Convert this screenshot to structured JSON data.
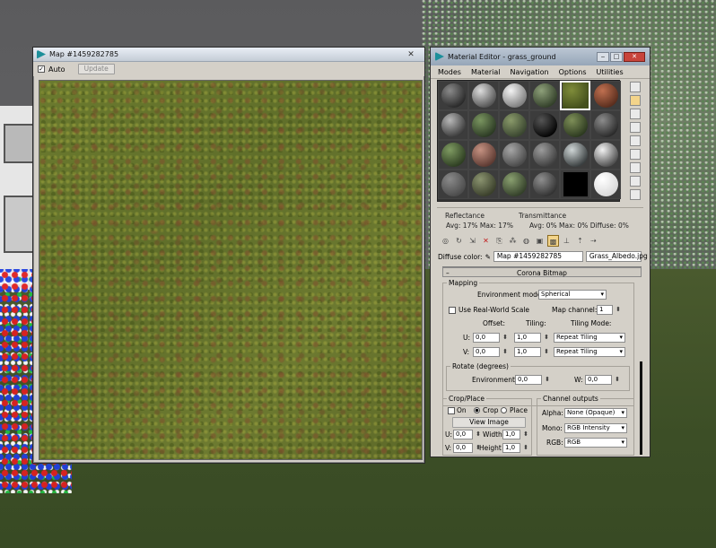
{
  "map_window": {
    "title": "Map #1459282785",
    "close": "✕",
    "auto_label": "Auto",
    "auto_checked": true,
    "update_label": "Update"
  },
  "material_editor": {
    "title": "Material Editor - grass_ground",
    "window_controls": [
      "‒",
      "□",
      "✕"
    ],
    "menu": [
      "Modes",
      "Material",
      "Navigation",
      "Options",
      "Utilities"
    ],
    "reflectance_label": "Reflectance",
    "reflectance_values": "Avg: 17% Max: 17%",
    "transmittance_label": "Transmittance",
    "transmittance_values": "Avg:  0% Max:   0% Diffuse:  0%",
    "diffuse_label": "Diffuse color:",
    "diffuse_map": "Map #1459282785",
    "diffuse_file": "Grass_Albedo.jpg",
    "rollout_title": "Corona Bitmap",
    "mapping_label": "Mapping",
    "env_mode_label": "Environment mode:",
    "env_mode_value": "Spherical",
    "real_world_label": "Use Real-World Scale",
    "map_channel_label": "Map channel:",
    "map_channel_value": "1",
    "offset_label": "Offset:",
    "tiling_label": "Tiling:",
    "tiling_mode_label": "Tiling Mode:",
    "u_label": "U:",
    "v_label": "V:",
    "u_offset": "0,0",
    "u_tiling": "1,0",
    "u_mode": "Repeat Tiling",
    "v_offset": "0,0",
    "v_tiling": "1,0",
    "v_mode": "Repeat Tiling",
    "rotate_label": "Rotate (degrees)",
    "environment_label": "Environment:",
    "environment_value": "0,0",
    "w_label": "W:",
    "w_value": "0,0",
    "crop_label": "Crop/Place",
    "on_label": "On",
    "crop_radio": "Crop",
    "place_radio": "Place",
    "view_image_label": "View Image",
    "u_crop": "0,0",
    "width_label": "Width",
    "width_value": "1,0",
    "v_crop": "0,0",
    "height_label": "Height",
    "height_value": "1,0",
    "channel_outputs_label": "Channel outputs",
    "alpha_label": "Alpha:",
    "alpha_value": "None (Opaque)",
    "mono_label": "Mono:",
    "mono_value": "RGB Intensity",
    "rgb_label": "RGB:",
    "rgb_value": "RGB"
  },
  "sample_slots": [
    {
      "name": "dark-rough-metal",
      "c1": "#8a8a8a",
      "c2": "#2a2a2a"
    },
    {
      "name": "brushed-metal",
      "c1": "#dddddd",
      "c2": "#555555"
    },
    {
      "name": "white-plaster",
      "c1": "#f4f4f4",
      "c2": "#7f7f7f"
    },
    {
      "name": "moss-stone",
      "c1": "#8ea07a",
      "c2": "#33402a"
    },
    {
      "name": "grass-ground",
      "c1": "#7f8c3a",
      "c2": "#44501c"
    },
    {
      "name": "rusty-metal",
      "c1": "#c07050",
      "c2": "#5a2e1e"
    },
    {
      "name": "checker-tile",
      "c1": "#b8b8b8",
      "c2": "#3a3a3a"
    },
    {
      "name": "green-stone",
      "c1": "#7a9560",
      "c2": "#2c3a24"
    },
    {
      "name": "mossy-rock",
      "c1": "#8a9a6a",
      "c2": "#3a4630"
    },
    {
      "name": "black-gloss",
      "c1": "#555555",
      "c2": "#050505"
    },
    {
      "name": "forest-ground",
      "c1": "#7e8f58",
      "c2": "#2d3a20"
    },
    {
      "name": "dark-stone",
      "c1": "#8c8c8c",
      "c2": "#2b2b2b"
    },
    {
      "name": "leaf-texture",
      "c1": "#7f9b62",
      "c2": "#2e3e22"
    },
    {
      "name": "clay-brick",
      "c1": "#c59282",
      "c2": "#5d3a32"
    },
    {
      "name": "concrete",
      "c1": "#a6a6a6",
      "c2": "#4a4a4a"
    },
    {
      "name": "grey-tile",
      "c1": "#9c9c9c",
      "c2": "#3f3f3f"
    },
    {
      "name": "glass",
      "c1": "#cfd6d6",
      "c2": "#3a3f40"
    },
    {
      "name": "chrome",
      "c1": "#f2f2f2",
      "c2": "#4f4f4f"
    },
    {
      "name": "empty-grey",
      "c1": "#8a8a8a",
      "c2": "#4c4c4c"
    },
    {
      "name": "lichen-rock",
      "c1": "#8b9470",
      "c2": "#3a3f2b"
    },
    {
      "name": "moss-ground",
      "c1": "#8aa070",
      "c2": "#34402a"
    },
    {
      "name": "slate",
      "c1": "#8f8f8f",
      "c2": "#333333"
    },
    {
      "name": "black-void",
      "c1": "#000000",
      "c2": "#000000"
    },
    {
      "name": "white-emissive",
      "c1": "#ffffff",
      "c2": "#d9d9d9"
    }
  ]
}
